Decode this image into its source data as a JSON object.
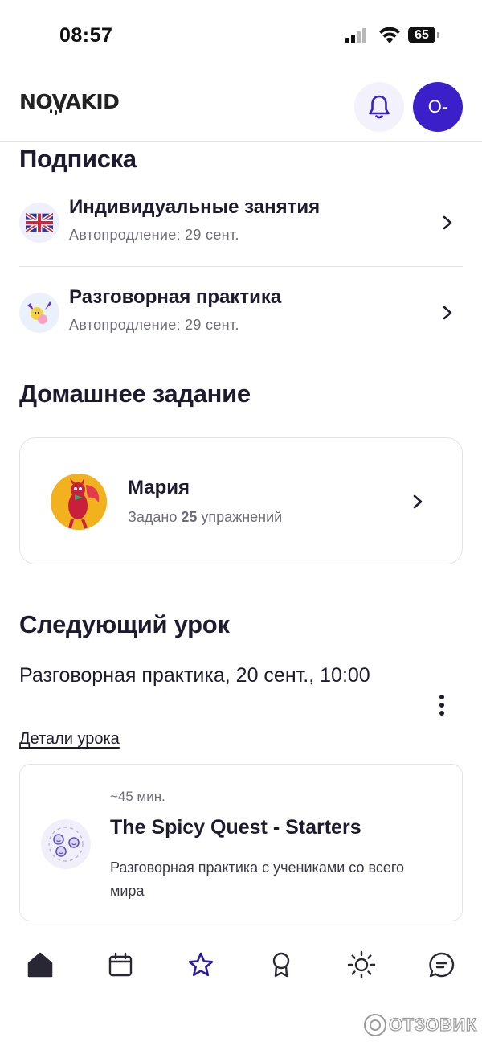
{
  "status_bar": {
    "time": "08:57",
    "battery": "65"
  },
  "header": {
    "logo": "NOVAKID",
    "bell_icon": "bell-icon",
    "avatar_initials": "O-",
    "accent": "#3b1fc9"
  },
  "subscriptions": {
    "title": "Подписка",
    "items": [
      {
        "title": "Индивидуальные занятия",
        "subtitle": "Автопродление: 29 сент.",
        "icon": "uk-flag-icon"
      },
      {
        "title": "Разговорная практика",
        "subtitle": "Автопродление: 29 сент.",
        "icon": "conversation-practice-icon"
      }
    ]
  },
  "homework": {
    "title": "Домашнее задание",
    "student_name": "Мария",
    "assigned_prefix": "Задано",
    "assigned_count": "25",
    "assigned_suffix": "упражнений"
  },
  "next_lesson": {
    "title": "Следующий урок",
    "when": "Разговорная практика, 20 сент., 10:00",
    "details_link": "Детали урока",
    "duration": "~45 мин.",
    "lesson_title": "The Spicy Quest - Starters",
    "description": "Разговорная практика с учениками со всего мира"
  },
  "bottom_nav": {
    "items": [
      "home-icon",
      "calendar-icon",
      "star-icon",
      "award-icon",
      "sun-icon",
      "chat-icon"
    ],
    "active_color": "#2b1c9e"
  },
  "watermark": "ОТЗОВИК"
}
